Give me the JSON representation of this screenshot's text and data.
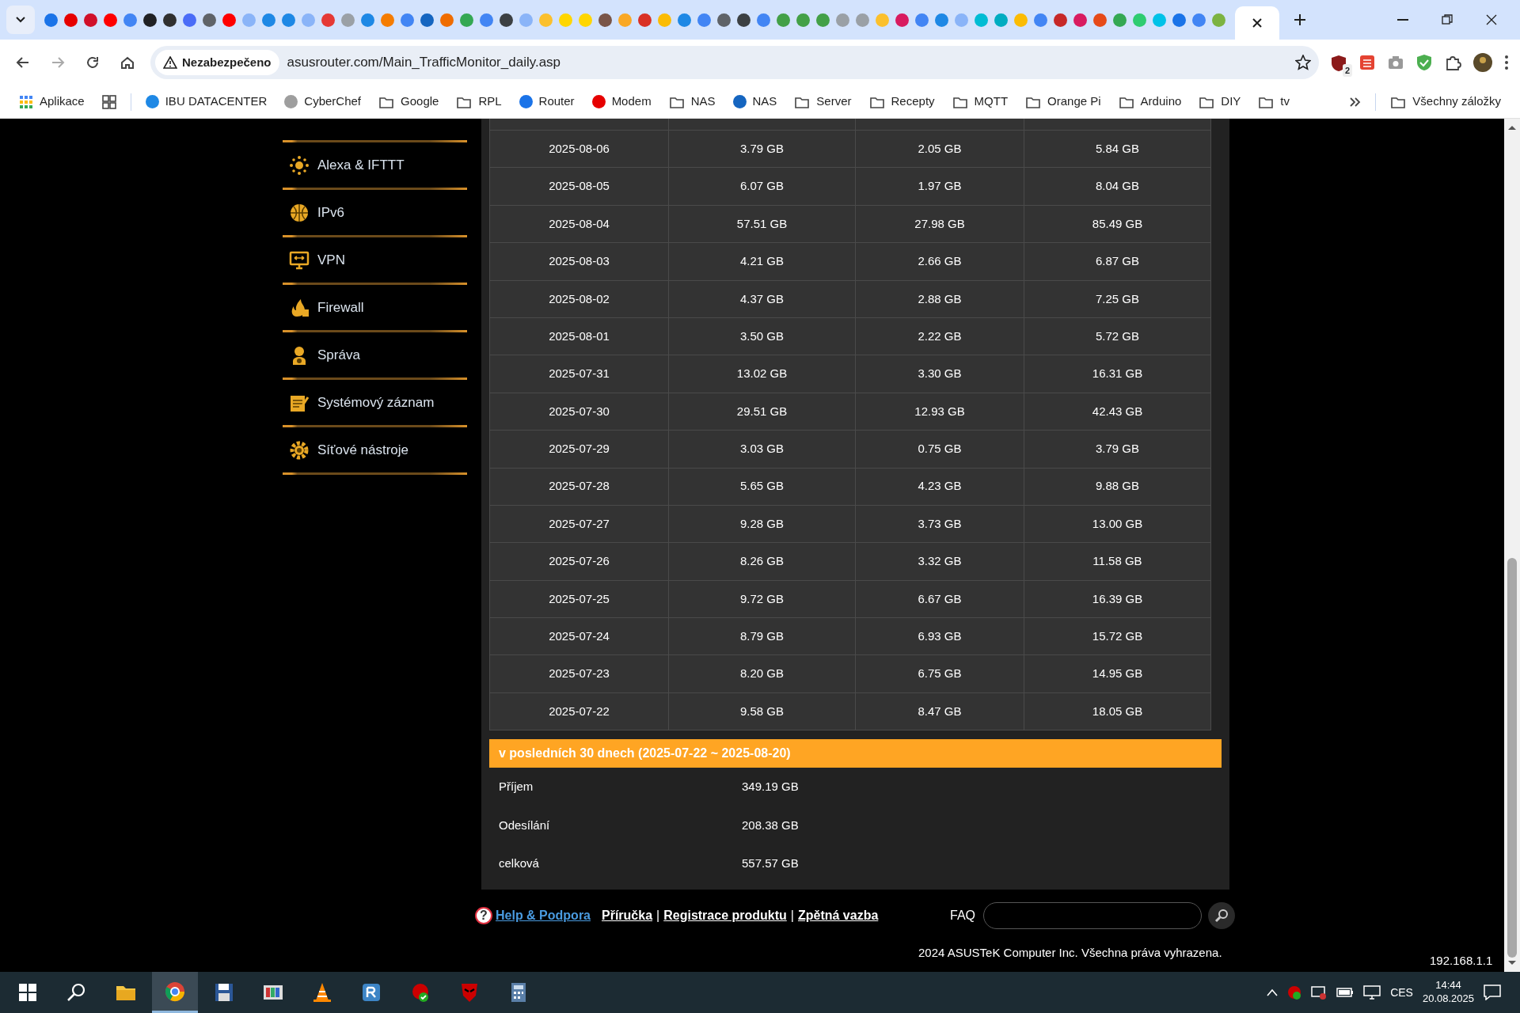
{
  "browser": {
    "tabs": [
      {
        "color": "#1a73e8",
        "selected": false
      },
      {
        "color": "#e60000",
        "selected": false
      },
      {
        "color": "#d0102a",
        "selected": false
      },
      {
        "color": "#ff0000",
        "selected": false
      },
      {
        "color": "#4285f4",
        "selected": false
      },
      {
        "color": "#202124",
        "selected": false
      },
      {
        "color": "#303030",
        "selected": false
      },
      {
        "color": "#4a6cf7",
        "selected": false
      },
      {
        "color": "#5f6368",
        "selected": false
      },
      {
        "color": "#ff0000",
        "selected": false
      },
      {
        "color": "#8ab4f8",
        "selected": false
      },
      {
        "color": "#1e88e5",
        "selected": false
      },
      {
        "color": "#1e88e5",
        "selected": false
      },
      {
        "color": "#8ab4f8",
        "selected": false
      },
      {
        "color": "#e53935",
        "selected": false
      },
      {
        "color": "#9aa0a6",
        "selected": false
      },
      {
        "color": "#1e88e5",
        "selected": false
      },
      {
        "color": "#f57c00",
        "selected": false
      },
      {
        "color": "#4285f4",
        "selected": false
      },
      {
        "color": "#1565c0",
        "selected": false
      },
      {
        "color": "#ef6c00",
        "selected": false
      },
      {
        "color": "#34a853",
        "selected": false
      },
      {
        "color": "#4285f4",
        "selected": false
      },
      {
        "color": "#3c4043",
        "selected": false
      },
      {
        "color": "#8ab4f8",
        "selected": false
      },
      {
        "color": "#fbc02d",
        "selected": false
      },
      {
        "color": "#ffd600",
        "selected": false
      },
      {
        "color": "#ffd600",
        "selected": false
      },
      {
        "color": "#795548",
        "selected": false
      },
      {
        "color": "#f9a825",
        "selected": false
      },
      {
        "color": "#d93025",
        "selected": false
      },
      {
        "color": "#fbbc04",
        "selected": false
      },
      {
        "color": "#1e88e5",
        "selected": false
      },
      {
        "color": "#4285f4",
        "selected": false
      },
      {
        "color": "#5f6368",
        "selected": false
      },
      {
        "color": "#3c4043",
        "selected": false
      },
      {
        "color": "#4285f4",
        "selected": false
      },
      {
        "color": "#43a047",
        "selected": false
      },
      {
        "color": "#43a047",
        "selected": false
      },
      {
        "color": "#43a047",
        "selected": false
      },
      {
        "color": "#9aa0a6",
        "selected": false
      },
      {
        "color": "#9aa0a6",
        "selected": false
      },
      {
        "color": "#fbc02d",
        "selected": false
      },
      {
        "color": "#d81b60",
        "selected": false
      },
      {
        "color": "#4285f4",
        "selected": false
      },
      {
        "color": "#1e88e5",
        "selected": false
      },
      {
        "color": "#8ab4f8",
        "selected": false
      },
      {
        "color": "#00bcd4",
        "selected": false
      },
      {
        "color": "#00acc1",
        "selected": false
      },
      {
        "color": "#fbbc04",
        "selected": false
      },
      {
        "color": "#4285f4",
        "selected": false
      },
      {
        "color": "#c62828",
        "selected": false
      },
      {
        "color": "#d81b60",
        "selected": false
      },
      {
        "color": "#e64a19",
        "selected": false
      },
      {
        "color": "#34a853",
        "selected": false
      },
      {
        "color": "#2ecc71",
        "selected": false
      },
      {
        "color": "#00c2e8",
        "selected": false
      },
      {
        "color": "#1a73e8",
        "selected": false
      },
      {
        "color": "#4285f4",
        "selected": false
      },
      {
        "color": "#7cb342",
        "selected": false
      },
      {
        "selected": true
      }
    ],
    "security_label": "Nezabezpečeno",
    "url": "asusrouter.com/Main_TrafficMonitor_daily.asp",
    "extension_badge": "2",
    "bookmarks": [
      {
        "kind": "apps",
        "label": "Aplikace"
      },
      {
        "kind": "grid"
      },
      {
        "kind": "separator"
      },
      {
        "kind": "site",
        "label": "IBU DATACENTER",
        "color": "#1e88e5"
      },
      {
        "kind": "site",
        "label": "CyberChef",
        "color": "#9e9e9e"
      },
      {
        "kind": "folder",
        "label": "Google"
      },
      {
        "kind": "folder",
        "label": "RPL"
      },
      {
        "kind": "site",
        "label": "Router",
        "color": "#1a73e8"
      },
      {
        "kind": "site",
        "label": "Modem",
        "color": "#e60000"
      },
      {
        "kind": "folder",
        "label": "NAS"
      },
      {
        "kind": "site",
        "label": "NAS",
        "color": "#1565c0"
      },
      {
        "kind": "folder",
        "label": "Server"
      },
      {
        "kind": "folder",
        "label": "Recepty"
      },
      {
        "kind": "folder",
        "label": "MQTT"
      },
      {
        "kind": "folder",
        "label": "Orange Pi"
      },
      {
        "kind": "folder",
        "label": "Arduino"
      },
      {
        "kind": "folder",
        "label": "DIY"
      },
      {
        "kind": "folder",
        "label": "tv"
      }
    ],
    "all_bookmarks": "Všechny záložky"
  },
  "sidebar": {
    "items": [
      {
        "kind": "alexa",
        "label": "Alexa & IFTTT"
      },
      {
        "kind": "ipv6",
        "label": "IPv6"
      },
      {
        "kind": "vpn",
        "label": "VPN"
      },
      {
        "kind": "firewall",
        "label": "Firewall"
      },
      {
        "kind": "admin",
        "label": "Správa"
      },
      {
        "kind": "log",
        "label": "Systémový záznam"
      },
      {
        "kind": "tools",
        "label": "Síťové nástroje"
      }
    ]
  },
  "table": {
    "rows": [
      [
        "2025-08-06",
        "3.79 GB",
        "2.05 GB",
        "5.84 GB"
      ],
      [
        "2025-08-05",
        "6.07 GB",
        "1.97 GB",
        "8.04 GB"
      ],
      [
        "2025-08-04",
        "57.51 GB",
        "27.98 GB",
        "85.49 GB"
      ],
      [
        "2025-08-03",
        "4.21 GB",
        "2.66 GB",
        "6.87 GB"
      ],
      [
        "2025-08-02",
        "4.37 GB",
        "2.88 GB",
        "7.25 GB"
      ],
      [
        "2025-08-01",
        "3.50 GB",
        "2.22 GB",
        "5.72 GB"
      ],
      [
        "2025-07-31",
        "13.02 GB",
        "3.30 GB",
        "16.31 GB"
      ],
      [
        "2025-07-30",
        "29.51 GB",
        "12.93 GB",
        "42.43 GB"
      ],
      [
        "2025-07-29",
        "3.03 GB",
        "0.75 GB",
        "3.79 GB"
      ],
      [
        "2025-07-28",
        "5.65 GB",
        "4.23 GB",
        "9.88 GB"
      ],
      [
        "2025-07-27",
        "9.28 GB",
        "3.73 GB",
        "13.00 GB"
      ],
      [
        "2025-07-26",
        "8.26 GB",
        "3.32 GB",
        "11.58 GB"
      ],
      [
        "2025-07-25",
        "9.72 GB",
        "6.67 GB",
        "16.39 GB"
      ],
      [
        "2025-07-24",
        "8.79 GB",
        "6.93 GB",
        "15.72 GB"
      ],
      [
        "2025-07-23",
        "8.20 GB",
        "6.75 GB",
        "14.95 GB"
      ],
      [
        "2025-07-22",
        "9.58 GB",
        "8.47 GB",
        "18.05 GB"
      ]
    ]
  },
  "summary": {
    "title": "v posledních 30 dnech (2025-07-22 ~ 2025-08-20)",
    "rows": [
      {
        "label": "Příjem",
        "value": "349.19 GB"
      },
      {
        "label": "Odesílání",
        "value": "208.38 GB"
      },
      {
        "label": "celková",
        "value": "557.57 GB"
      }
    ]
  },
  "footer": {
    "help_icon": "?",
    "help": "Help & Podpora",
    "links": [
      {
        "kind": "link",
        "text": "Příručka"
      },
      {
        "kind": "sep",
        "text": "|"
      },
      {
        "kind": "link",
        "text": "Registrace produktu"
      },
      {
        "kind": "sep",
        "text": "|"
      },
      {
        "kind": "link",
        "text": "Zpětná vazba"
      }
    ],
    "faq_label": "FAQ",
    "copyright": "2024 ASUSTeK Computer Inc. Všechna práva vyhrazena.",
    "ip": "192.168.1.1"
  },
  "taskbar": {
    "language": "CES",
    "time": "14:44",
    "date": "20.08.2025"
  }
}
